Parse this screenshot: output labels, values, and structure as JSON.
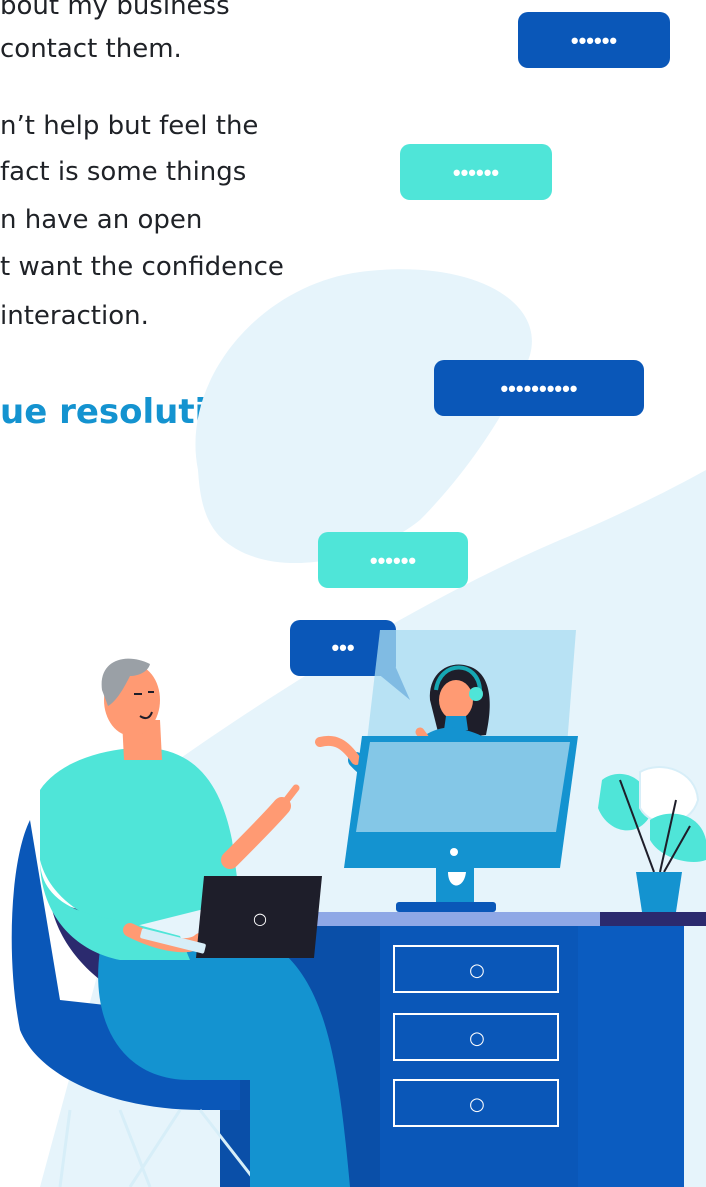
{
  "article": {
    "paragraph_1": [
      "bout my business",
      "contact them."
    ],
    "paragraph_2": [
      "n’t help but feel the",
      "fact is some things",
      "n have an open",
      "t want the confidence",
      "interaction."
    ],
    "heading": "ue resolution"
  },
  "illustration": {
    "bubbles": [
      "••••••",
      "••••••",
      "••••••••••",
      "••••••",
      "•••"
    ],
    "drawer_knobs": [
      "○",
      "○",
      "○"
    ],
    "laptop_logo": "○",
    "icons": [
      "man-figure-icon",
      "headset-woman-icon",
      "monitor-icon",
      "plant-icon",
      "desk-icon",
      "chair-icon",
      "laptop-icon"
    ]
  },
  "colors": {
    "navy": "#0a57b8",
    "teal": "#4fe5d8",
    "light_blue": "#e6f4fb",
    "heading_blue": "#1493d0"
  }
}
